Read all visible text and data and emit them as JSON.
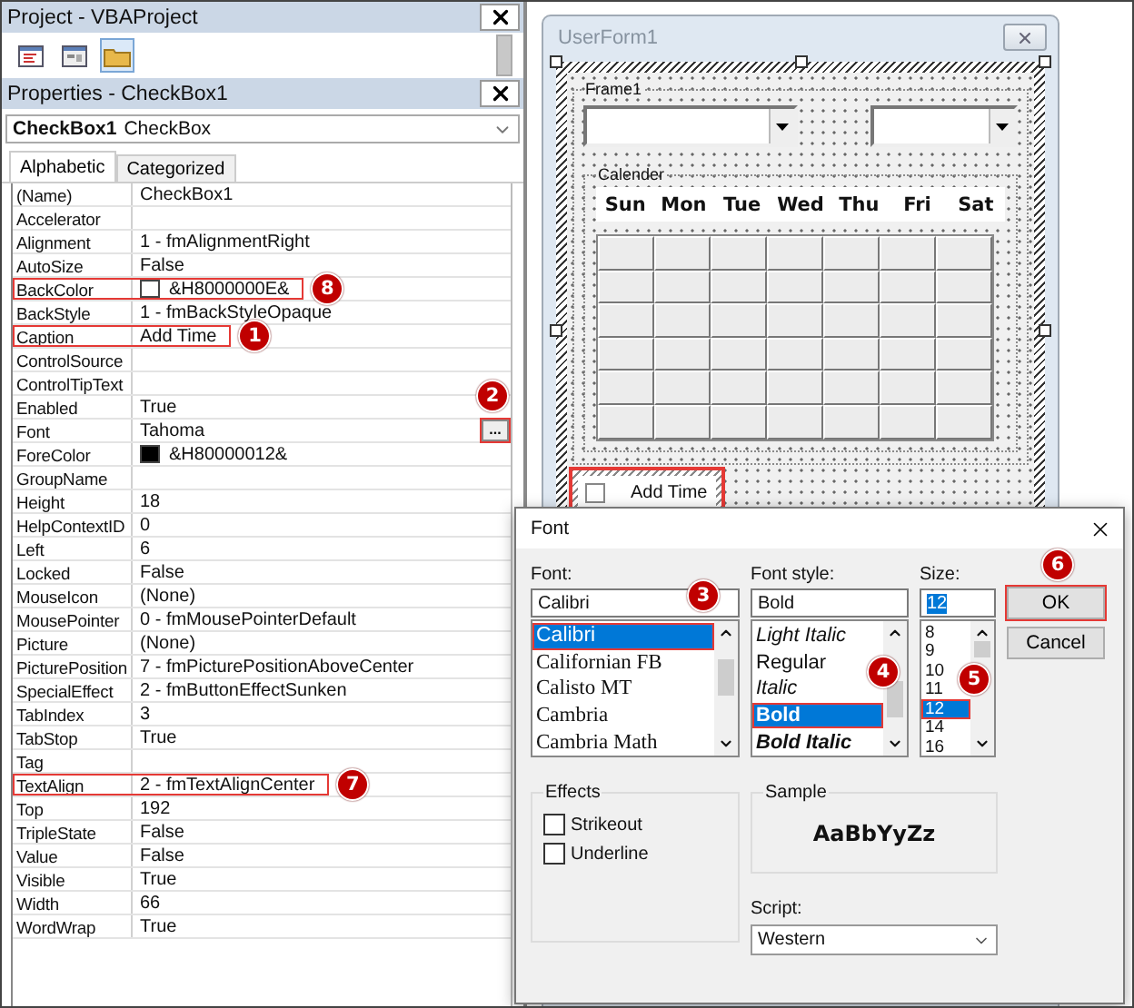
{
  "project_pane": {
    "title": "Project - VBAProject"
  },
  "properties_pane": {
    "title": "Properties - CheckBox1",
    "object_name": "CheckBox1",
    "object_type": "CheckBox",
    "tabs": [
      {
        "label": "Alphabetic",
        "selected": true
      },
      {
        "label": "Categorized",
        "selected": false
      }
    ],
    "rows": [
      {
        "name": "(Name)",
        "value": "CheckBox1",
        "highlighted": false
      },
      {
        "name": "Accelerator",
        "highlighted": false
      },
      {
        "name": "Alignment",
        "value": "1 - fmAlignmentRight",
        "highlighted": false
      },
      {
        "name": "AutoSize",
        "value": "False",
        "highlighted": false
      },
      {
        "name": "BackColor",
        "value": "&H8000000E&",
        "color": "#ffffff",
        "highlighted": true,
        "marker": "8"
      },
      {
        "name": "BackStyle",
        "value": "1 - fmBackStyleOpaque",
        "highlighted": false
      },
      {
        "name": "Caption",
        "value": "Add Time",
        "highlighted": true,
        "marker": "1"
      },
      {
        "name": "ControlSource",
        "highlighted": false
      },
      {
        "name": "ControlTipText",
        "highlighted": false
      },
      {
        "name": "Enabled",
        "value": "True",
        "highlighted": false
      },
      {
        "name": "Font",
        "value": "Tahoma",
        "highlighted": false,
        "button": {
          "label": "...",
          "highlighted": true,
          "marker": "2"
        }
      },
      {
        "name": "ForeColor",
        "value": "&H80000012&",
        "color": "#000000",
        "highlighted": false
      },
      {
        "name": "GroupName",
        "highlighted": false
      },
      {
        "name": "Height",
        "value": "18",
        "highlighted": false
      },
      {
        "name": "HelpContextID",
        "value": "0",
        "highlighted": false
      },
      {
        "name": "Left",
        "value": "6",
        "highlighted": false
      },
      {
        "name": "Locked",
        "value": "False",
        "highlighted": false
      },
      {
        "name": "MouseIcon",
        "value": "(None)",
        "highlighted": false
      },
      {
        "name": "MousePointer",
        "value": "0 - fmMousePointerDefault",
        "highlighted": false
      },
      {
        "name": "Picture",
        "value": "(None)",
        "highlighted": false
      },
      {
        "name": "PicturePosition",
        "value": "7 - fmPicturePositionAboveCenter",
        "highlighted": false
      },
      {
        "name": "SpecialEffect",
        "value": "2 - fmButtonEffectSunken",
        "highlighted": false
      },
      {
        "name": "TabIndex",
        "value": "3",
        "highlighted": false
      },
      {
        "name": "TabStop",
        "value": "True",
        "highlighted": false
      },
      {
        "name": "Tag",
        "highlighted": false
      },
      {
        "name": "TextAlign",
        "value": "2 - fmTextAlignCenter",
        "highlighted": true,
        "marker": "7"
      },
      {
        "name": "Top",
        "value": "192",
        "highlighted": false
      },
      {
        "name": "TripleState",
        "value": "False",
        "highlighted": false
      },
      {
        "name": "Value",
        "value": "False",
        "highlighted": false
      },
      {
        "name": "Visible",
        "value": "True",
        "highlighted": false
      },
      {
        "name": "Width",
        "value": "66",
        "highlighted": false
      },
      {
        "name": "WordWrap",
        "value": "True",
        "highlighted": false
      }
    ]
  },
  "userform": {
    "title": "UserForm1",
    "frame": "Frame1",
    "calendar": "Calender",
    "days": [
      "Sun",
      "Mon",
      "Tue",
      "Wed",
      "Thu",
      "Fri",
      "Sat"
    ],
    "checkbox": {
      "label": "Add Time",
      "checked": false,
      "highlighted": true
    }
  },
  "font_dialog": {
    "title": "Font",
    "font": {
      "label": "Font:",
      "value": "Calibri",
      "marker": "3",
      "options": [
        {
          "label": "Calibri",
          "kind": "sans",
          "selected": true
        },
        {
          "label": "Californian FB",
          "kind": "serif",
          "selected": false
        },
        {
          "label": "Calisto MT",
          "kind": "serif",
          "selected": false
        },
        {
          "label": "Cambria",
          "kind": "serif",
          "selected": false
        },
        {
          "label": "Cambria Math",
          "kind": "serif",
          "selected": false
        }
      ]
    },
    "style": {
      "label": "Font style:",
      "value": "Bold",
      "marker": "4",
      "options": [
        {
          "label": "Light Italic",
          "kind": "italic",
          "selected": false
        },
        {
          "label": "Regular",
          "kind": "regular",
          "selected": false
        },
        {
          "label": "Italic",
          "kind": "italic",
          "selected": false
        },
        {
          "label": "Bold",
          "kind": "bold",
          "selected": true
        },
        {
          "label": "Bold Italic",
          "kind": "bold-italic",
          "selected": false
        }
      ]
    },
    "size": {
      "label": "Size:",
      "value": "12",
      "marker": "5",
      "options": [
        {
          "label": "8",
          "selected": false
        },
        {
          "label": "9",
          "selected": false
        },
        {
          "label": "10",
          "selected": false
        },
        {
          "label": "11",
          "selected": false
        },
        {
          "label": "12",
          "selected": true
        },
        {
          "label": "14",
          "selected": false
        },
        {
          "label": "16",
          "selected": false
        }
      ]
    },
    "buttons": [
      {
        "label": "OK",
        "highlighted": true,
        "marker": "6"
      },
      {
        "label": "Cancel",
        "highlighted": false
      }
    ],
    "effects": {
      "label": "Effects",
      "options": [
        {
          "label": "Strikeout",
          "checked": false
        },
        {
          "label": "Underline",
          "checked": false
        }
      ]
    },
    "sample": {
      "label": "Sample",
      "text": "AaBbYyZz"
    },
    "script": {
      "label": "Script:",
      "value": "Western"
    }
  }
}
